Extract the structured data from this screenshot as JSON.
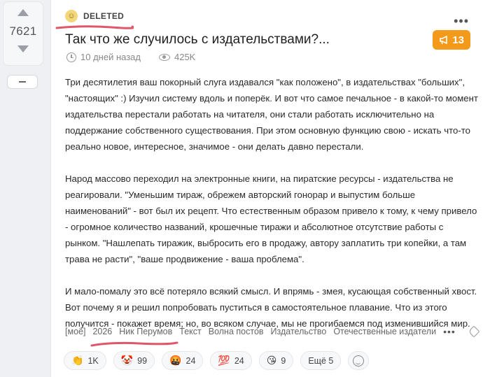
{
  "vote": {
    "count": "7621",
    "minus_label": ""
  },
  "post": {
    "author": "DELETED",
    "title": "Так что же случилось с издательствами?...",
    "badge_count": "13",
    "time": "10 дней назад",
    "views": "425K",
    "paragraphs": [
      "Три десятилетия ваш покорный слуга издавался \"как положено\", в издательствах \"больших\", \"настоящих\" :) Изучил систему вдоль и поперёк. И вот что самое печальное - в какой-то момент издательства перестали работать на читателя, они стали работать исключительно на поддержание собственного существования. При этом основную функцию свою - искать что-то реально новое, интересное, значимое - они делать давно перестали.",
      "Народ массово переходил на электронные книги, на пиратские ресурсы - издательства не реагировали. \"Уменьшим тираж, обрежем авторский гонорар и выпустим больше наименований\" - вот был их рецепт. Что естественным образом привело к тому, к чему привело - огромное количество названий, крошечные тиражи и абсолютное отсутствие работы с рынком. \"Нашлепать тиражик, выбросить его в продажу, автору заплатить три копейки, а там трава не расти\", \"ваше продвижение - ваша проблема\".",
      "И мало-помалу это всё потеряло всякий смысл. И впрямь - змея, кусающая собственный хвост. Вот почему я и решил попробовать пуститься в самостоятельное плавание. Что из этого получится - покажет время; но, во всяком случае, мы не прогибаемся под изменившийся мир."
    ],
    "tags": [
      "[моё]",
      "2026",
      "Ник Перумов",
      "Текст",
      "Волна постов",
      "Издательство",
      "Отечественные издатели"
    ]
  },
  "reactions": [
    {
      "emoji": "👏",
      "count": "1K"
    },
    {
      "emoji": "🤡",
      "count": "99"
    },
    {
      "emoji": "🤬",
      "count": "24"
    },
    {
      "emoji": "💯",
      "count": "24"
    },
    {
      "emoji": "😘",
      "count": "9"
    }
  ],
  "reactions_more": "Ещё 5",
  "colors": {
    "badge": "#f39a1a",
    "highlight_underline": "#e0566b"
  }
}
